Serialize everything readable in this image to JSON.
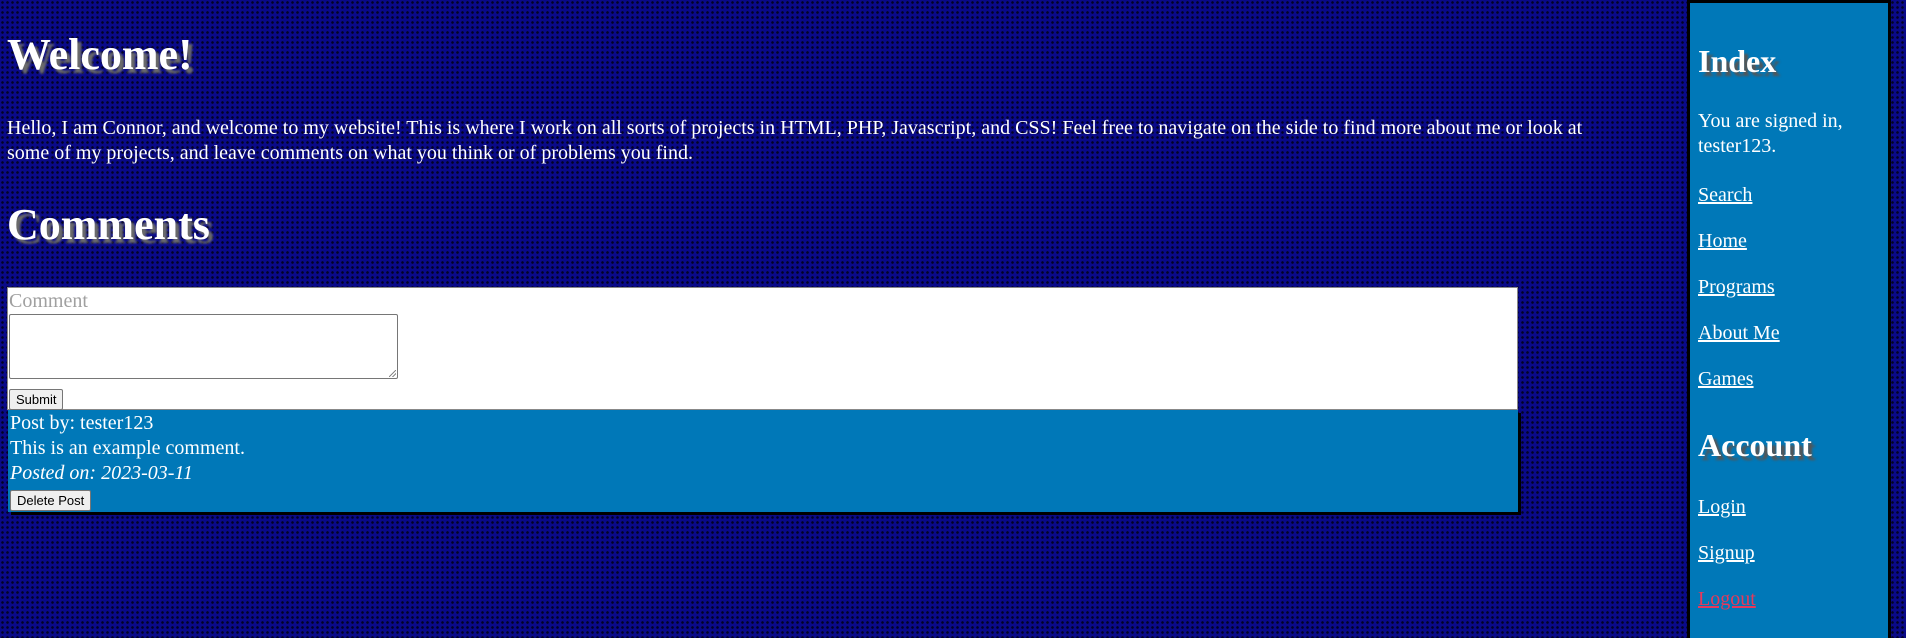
{
  "main": {
    "welcome_title": "Welcome!",
    "intro_text": "Hello, I am Connor, and welcome to my website! This is where I work on all sorts of projects in HTML, PHP, Javascript, and CSS! Feel free to navigate on the side to find more about me or look at some of my projects, and leave comments on what you think or of problems you find.",
    "comments_title": "Comments",
    "comment_form": {
      "label": "Comment",
      "textarea_value": "",
      "submit_label": "Submit"
    },
    "posts": [
      {
        "author_line": "Post by: tester123",
        "body": "This is an example comment.",
        "date_line": "Posted on: 2023-03-11",
        "delete_label": "Delete Post"
      }
    ]
  },
  "sidebar": {
    "index_title": "Index",
    "signed_in_text": "You are signed in, tester123.",
    "nav_links": [
      {
        "label": "Search"
      },
      {
        "label": "Home"
      },
      {
        "label": "Programs"
      },
      {
        "label": "About Me"
      },
      {
        "label": "Games"
      }
    ],
    "account_title": "Account",
    "account_links": [
      {
        "label": "Login"
      },
      {
        "label": "Signup"
      },
      {
        "label": "Logout"
      }
    ]
  },
  "colors": {
    "background": "#0a0a88",
    "panel": "#0078b8",
    "logout_link": "#e8385a"
  }
}
